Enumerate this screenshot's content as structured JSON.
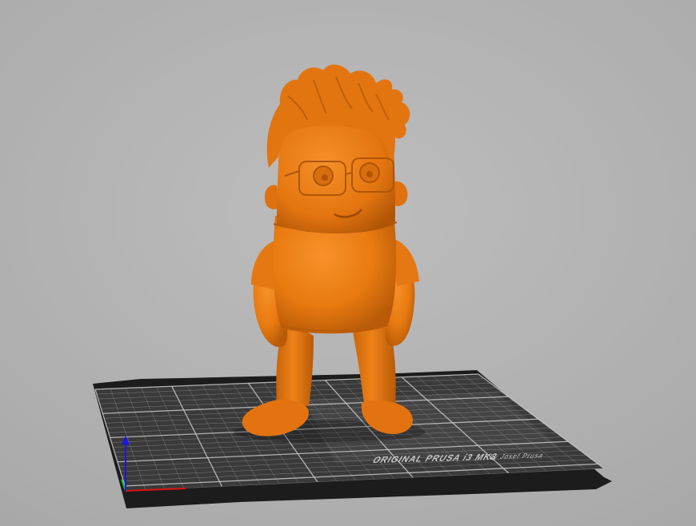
{
  "app": {
    "view": "3d-viewport"
  },
  "print_bed": {
    "brand_text": "ORIGINAL PRUSA i3 MK3",
    "sub_text": "by Josef Prusa",
    "sheet_color": "#3a3a3a",
    "frame_color": "#1c1c1c",
    "grid_color": "#c8c8c8"
  },
  "model": {
    "color": "#e87a10",
    "color_dark": "#b85a08",
    "color_shadow": "#8f4305"
  },
  "axes": {
    "x_color": "#e01010",
    "y_color": "#10c020",
    "z_color": "#1818e0"
  },
  "background_color": "#ababab"
}
